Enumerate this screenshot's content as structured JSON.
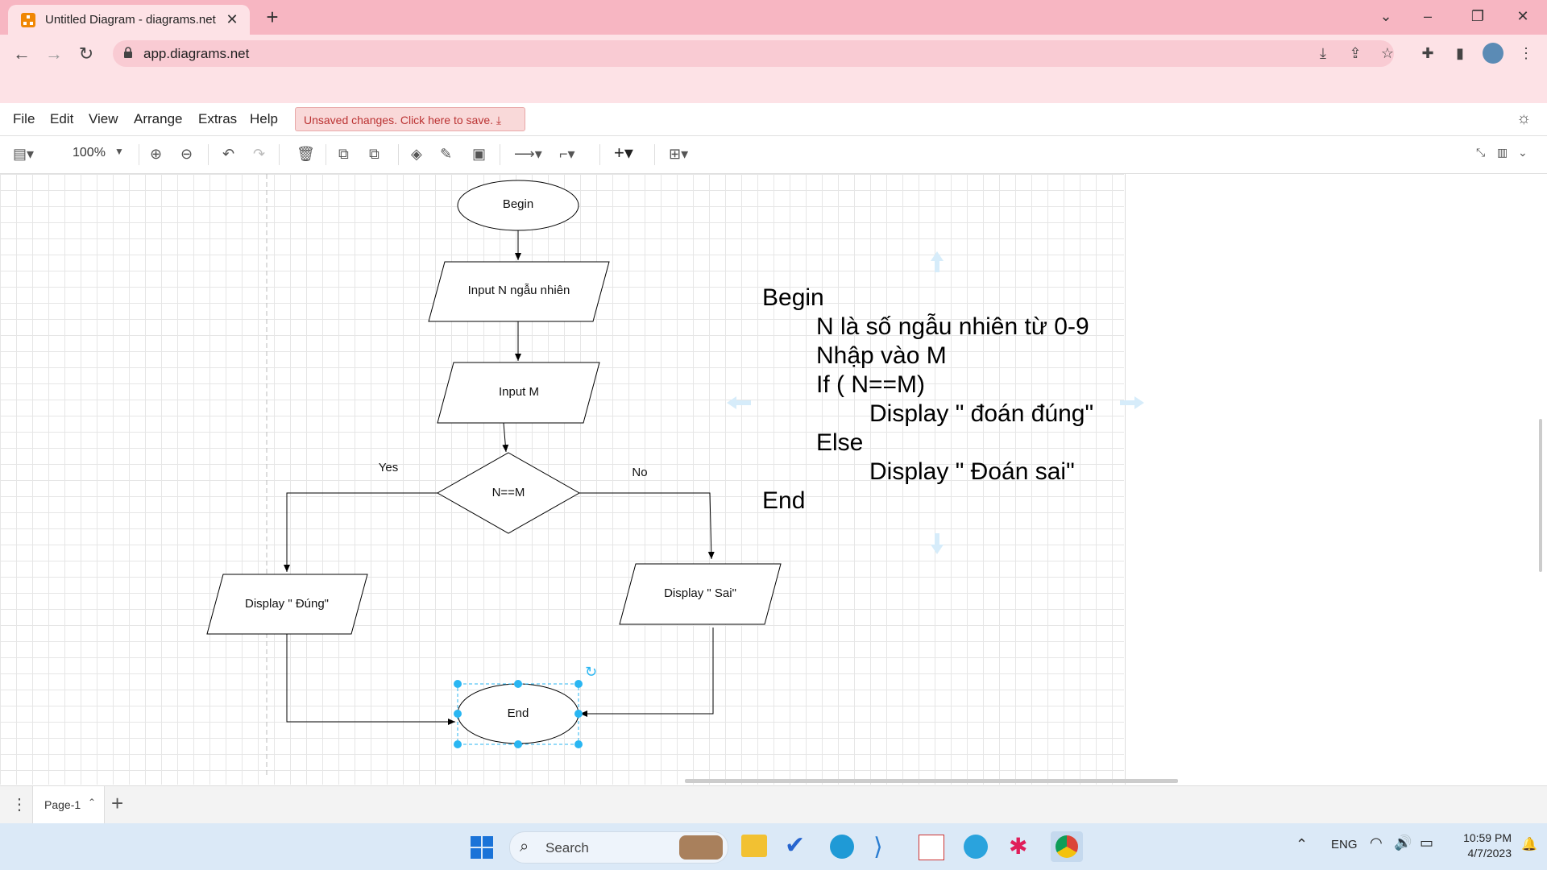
{
  "browser": {
    "tab_title": "Untitled Diagram - diagrams.net",
    "url": "app.diagrams.net"
  },
  "menu": {
    "items": [
      "File",
      "Edit",
      "View",
      "Arrange",
      "Extras",
      "Help"
    ],
    "unsaved_label": "Unsaved changes. Click here to save."
  },
  "toolbar": {
    "zoom": "100%"
  },
  "diagram": {
    "begin": "Begin",
    "input_n": "Input N ngẫu nhiên",
    "input_m": "Input M",
    "condition": "N==M",
    "yes_label": "Yes",
    "no_label": "No",
    "display_true": "Display \" Đúng\"",
    "display_false": "Display \" Sai\"",
    "end": "End"
  },
  "pseudocode": {
    "lines": [
      "Begin",
      "N là số ngẫu nhiên từ 0-9",
      "Nhập vào M",
      "If ( N==M)",
      "Display \" đoán đúng\"",
      "Else",
      "Display \" Đoán sai\"",
      "End"
    ]
  },
  "pages": {
    "current": "Page-1"
  },
  "taskbar": {
    "search": "Search",
    "language": "ENG",
    "time": "10:59 PM",
    "date": "4/7/2023"
  },
  "colors": {
    "chrome_pink": "#f7b6c2",
    "selection_blue": "#29b6f2",
    "unsaved_red": "#b33"
  }
}
